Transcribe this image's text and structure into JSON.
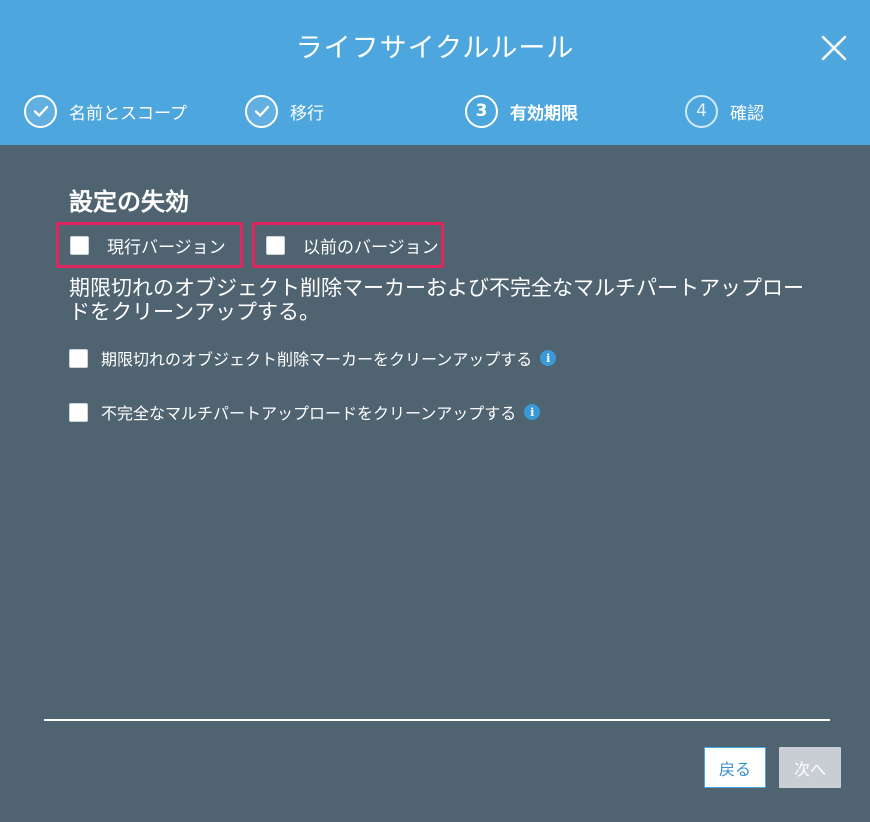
{
  "dialog": {
    "title": "ライフサイクルルール"
  },
  "steps": [
    {
      "number": "1",
      "label": "名前とスコープ",
      "state": "done"
    },
    {
      "number": "2",
      "label": "移行",
      "state": "done"
    },
    {
      "number": "3",
      "label": "有効期限",
      "state": "active"
    },
    {
      "number": "4",
      "label": "確認",
      "state": "todo"
    }
  ],
  "expiration": {
    "title": "設定の失効",
    "current_version_label": "現行バージョン",
    "previous_version_label": "以前のバージョン",
    "current_version_checked": false,
    "previous_version_checked": false
  },
  "cleanup": {
    "description": "期限切れのオブジェクト削除マーカーおよび不完全なマルチパートアップロードをクリーンアップする。",
    "options": [
      {
        "label": "期限切れのオブジェクト削除マーカーをクリーンアップする",
        "checked": false
      },
      {
        "label": "不完全なマルチパートアップロードをクリーンアップする",
        "checked": false
      }
    ]
  },
  "footer": {
    "back_label": "戻る",
    "next_label": "次へ"
  },
  "colors": {
    "header": "#4da6dd",
    "body": "#4f6370",
    "highlight": "#e0245e",
    "info": "#3a9ad9"
  },
  "icons": {
    "close": "close-icon",
    "check": "check-icon",
    "info": "info-icon"
  }
}
